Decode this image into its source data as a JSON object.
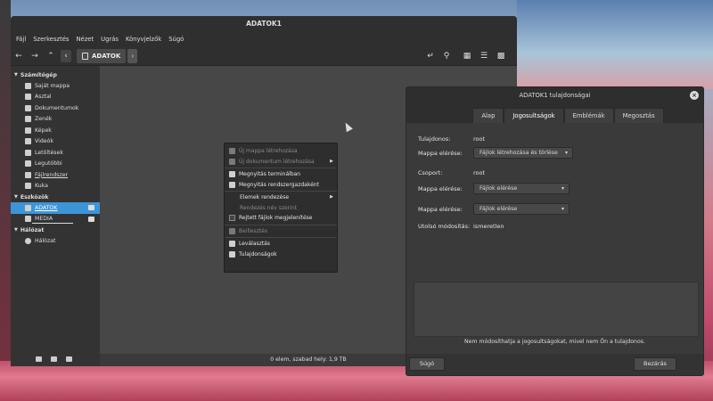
{
  "file_manager": {
    "window_title": "ADATOK1",
    "menu": [
      "Fájl",
      "Szerkesztés",
      "Nézet",
      "Ugrás",
      "Könyvjelzők",
      "Súgó"
    ],
    "path": "ADATOK",
    "sidebar": {
      "sections": [
        {
          "title": "Számítógép",
          "items": [
            {
              "label": "Saját mappa",
              "icon": "home-icon"
            },
            {
              "label": "Asztal",
              "icon": "desktop-icon"
            },
            {
              "label": "Dokumentumok",
              "icon": "documents-icon"
            },
            {
              "label": "Zenék",
              "icon": "music-icon"
            },
            {
              "label": "Képek",
              "icon": "pictures-icon"
            },
            {
              "label": "Videók",
              "icon": "videos-icon"
            },
            {
              "label": "Letöltések",
              "icon": "downloads-icon"
            },
            {
              "label": "Legutóbbi",
              "icon": "recent-icon"
            },
            {
              "label": "Fájlrendszer",
              "icon": "filesystem-icon"
            },
            {
              "label": "Kuka",
              "icon": "trash-icon"
            }
          ]
        },
        {
          "title": "Eszközök",
          "items": [
            {
              "label": "ADATOK",
              "icon": "drive-icon",
              "active": true
            },
            {
              "label": "MEDIA",
              "icon": "usb-icon"
            }
          ]
        },
        {
          "title": "Hálózat",
          "items": [
            {
              "label": "Hálózat",
              "icon": "network-icon"
            }
          ]
        }
      ]
    },
    "status": "0 elem, szabad hely: 1,9 TB"
  },
  "context_menu": {
    "items": [
      {
        "label": "Új mappa létrehozása",
        "dim": true,
        "icon": "new-folder-icon"
      },
      {
        "label": "Új dokumentum létrehozása",
        "dim": true,
        "icon": "new-document-icon",
        "submenu": true
      },
      {
        "label": "Megnyitás terminálban",
        "dim": false,
        "icon": "terminal-icon"
      },
      {
        "label": "Megnyitás rendszergazdaként",
        "dim": false,
        "icon": "key-icon"
      },
      {
        "label": "Elemek rendezése",
        "dim": false,
        "submenu": true
      },
      {
        "label": "Rendezés név szerint",
        "dim": true
      },
      {
        "label": "Rejtett fájlok megjelenítése",
        "dim": false,
        "checkbox": true
      },
      {
        "label": "Beillesztés",
        "dim": true,
        "icon": "paste-icon"
      },
      {
        "label": "Leválasztás",
        "dim": false,
        "icon": "eject-icon"
      },
      {
        "label": "Tulajdonságok",
        "dim": false,
        "icon": "properties-icon"
      }
    ]
  },
  "properties_dialog": {
    "title": "ADATOK1 tulajdonságai",
    "tabs": [
      "Alap",
      "Jogosultságok",
      "Emblémák",
      "Megosztás"
    ],
    "active_tab": "Jogosultságok",
    "owner_label": "Tulajdonos:",
    "owner_value": "root",
    "owner_access_label": "Mappa elérése:",
    "owner_access_value": "Fájlok létrehozása és törlése",
    "group_label": "Csoport:",
    "group_value": "root",
    "group_access_label": "Mappa elérése:",
    "group_access_value": "Fájlok elérése",
    "others_access_label": "Mappa elérése:",
    "others_access_value": "Fájlok elérése",
    "last_modified_label": "Utolsó módosítás:",
    "last_modified_value": "ismeretlen",
    "note": "Nem módosíthatja a jogosultságokat, mivel nem Ön a tulajdonos.",
    "help_button": "Súgó",
    "close_button": "Bezárás"
  },
  "colors": {
    "accent": "#3d95d8",
    "window_bg": "#3b3b3b"
  }
}
